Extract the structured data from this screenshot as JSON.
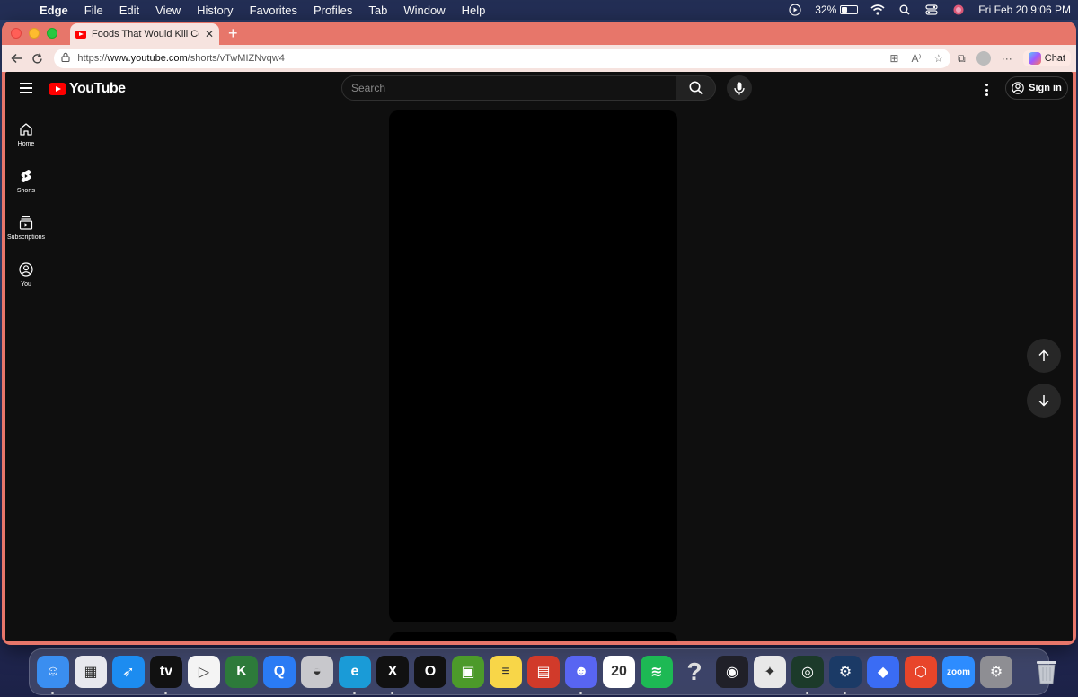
{
  "menubar": {
    "app_name": "Edge",
    "items": [
      "File",
      "Edit",
      "View",
      "History",
      "Favorites",
      "Profiles",
      "Tab",
      "Window",
      "Help"
    ],
    "battery_percent": "32%",
    "clock": "Fri Feb 20  9:06 PM"
  },
  "browser": {
    "tab_title": "Foods That Would Kill Celebrities",
    "url_scheme": "https://",
    "url_host": "www.youtube.com",
    "url_path": "/shorts/vTwMIZNvqw4",
    "chat_label": "Chat"
  },
  "youtube": {
    "logo_text": "YouTube",
    "search_placeholder": "Search",
    "signin_label": "Sign in",
    "sidebar": [
      {
        "label": "Home",
        "icon": "home-icon"
      },
      {
        "label": "Shorts",
        "icon": "shorts-icon"
      },
      {
        "label": "Subscriptions",
        "icon": "subscriptions-icon"
      },
      {
        "label": "You",
        "icon": "you-icon"
      }
    ]
  },
  "dock": {
    "apps": [
      {
        "name": "Finder",
        "icon": "finder-icon",
        "color": "#3a8ef0",
        "glyph": "☺",
        "running": true
      },
      {
        "name": "Launchpad",
        "icon": "launchpad-icon",
        "color": "#e8e8ee",
        "glyph": "▦",
        "running": false
      },
      {
        "name": "Safari",
        "icon": "safari-icon",
        "color": "#1c8cf0",
        "glyph": "➶",
        "running": false
      },
      {
        "name": "TV",
        "icon": "tv-icon",
        "color": "#111111",
        "glyph": "tv",
        "running": true
      },
      {
        "name": "Player",
        "icon": "player-icon",
        "color": "#f4f4f4",
        "glyph": "▷",
        "running": false
      },
      {
        "name": "Keka",
        "icon": "k-icon",
        "color": "#2d7a3a",
        "glyph": "K",
        "running": false
      },
      {
        "name": "QQ",
        "icon": "q-icon",
        "color": "#2a7bf4",
        "glyph": "Q",
        "running": false
      },
      {
        "name": "Drive",
        "icon": "drive-icon",
        "color": "#c8c8cc",
        "glyph": "◒",
        "running": false
      },
      {
        "name": "Edge",
        "icon": "edge-icon",
        "color": "#1a9bd7",
        "glyph": "e",
        "running": true
      },
      {
        "name": "X",
        "icon": "x-icon",
        "color": "#111111",
        "glyph": "X",
        "running": true
      },
      {
        "name": "Opera",
        "icon": "opera-icon",
        "color": "#111111",
        "glyph": "O",
        "running": false
      },
      {
        "name": "Minecraft",
        "icon": "minecraft-icon",
        "color": "#4c9a2a",
        "glyph": "▣",
        "running": false
      },
      {
        "name": "Notes",
        "icon": "notes-icon",
        "color": "#f8d648",
        "glyph": "≡",
        "running": false
      },
      {
        "name": "Photo Booth",
        "icon": "photobooth-icon",
        "color": "#d13a2a",
        "glyph": "▤",
        "running": false
      },
      {
        "name": "Discord",
        "icon": "discord-icon",
        "color": "#5865f2",
        "glyph": "☻",
        "running": true
      },
      {
        "name": "Calendar",
        "icon": "calendar-icon",
        "color": "#ffffff",
        "glyph": "20",
        "running": false
      },
      {
        "name": "Spotify",
        "icon": "spotify-icon",
        "color": "#1db954",
        "glyph": "≋",
        "running": false
      },
      {
        "name": "Unknown",
        "icon": "question-icon",
        "color": "transparent",
        "glyph": "?",
        "running": false
      },
      {
        "name": "OBS",
        "icon": "obs-icon",
        "color": "#202028",
        "glyph": "◉",
        "running": false
      },
      {
        "name": "Game",
        "icon": "game-icon",
        "color": "#e8e8e8",
        "glyph": "✦",
        "running": false
      },
      {
        "name": "Radar",
        "icon": "radar-icon",
        "color": "#1c3a2a",
        "glyph": "◎",
        "running": true
      },
      {
        "name": "Steam",
        "icon": "steam-icon",
        "color": "#1b3a66",
        "glyph": "⚙",
        "running": true
      },
      {
        "name": "Roblox",
        "icon": "roblox-icon",
        "color": "#3a6cf4",
        "glyph": "◆",
        "running": false
      },
      {
        "name": "Box",
        "icon": "box-icon",
        "color": "#e8452a",
        "glyph": "⬡",
        "running": false
      },
      {
        "name": "Zoom",
        "icon": "zoom-icon",
        "color": "#2d8cff",
        "glyph": "zoom",
        "running": false
      },
      {
        "name": "System Settings",
        "icon": "settings-icon",
        "color": "#8e8e93",
        "glyph": "⚙",
        "running": false
      }
    ]
  },
  "colors": {
    "edge_frame": "#e7766a",
    "youtube_red": "#ff0000",
    "yt_background": "#0f0f0f"
  }
}
